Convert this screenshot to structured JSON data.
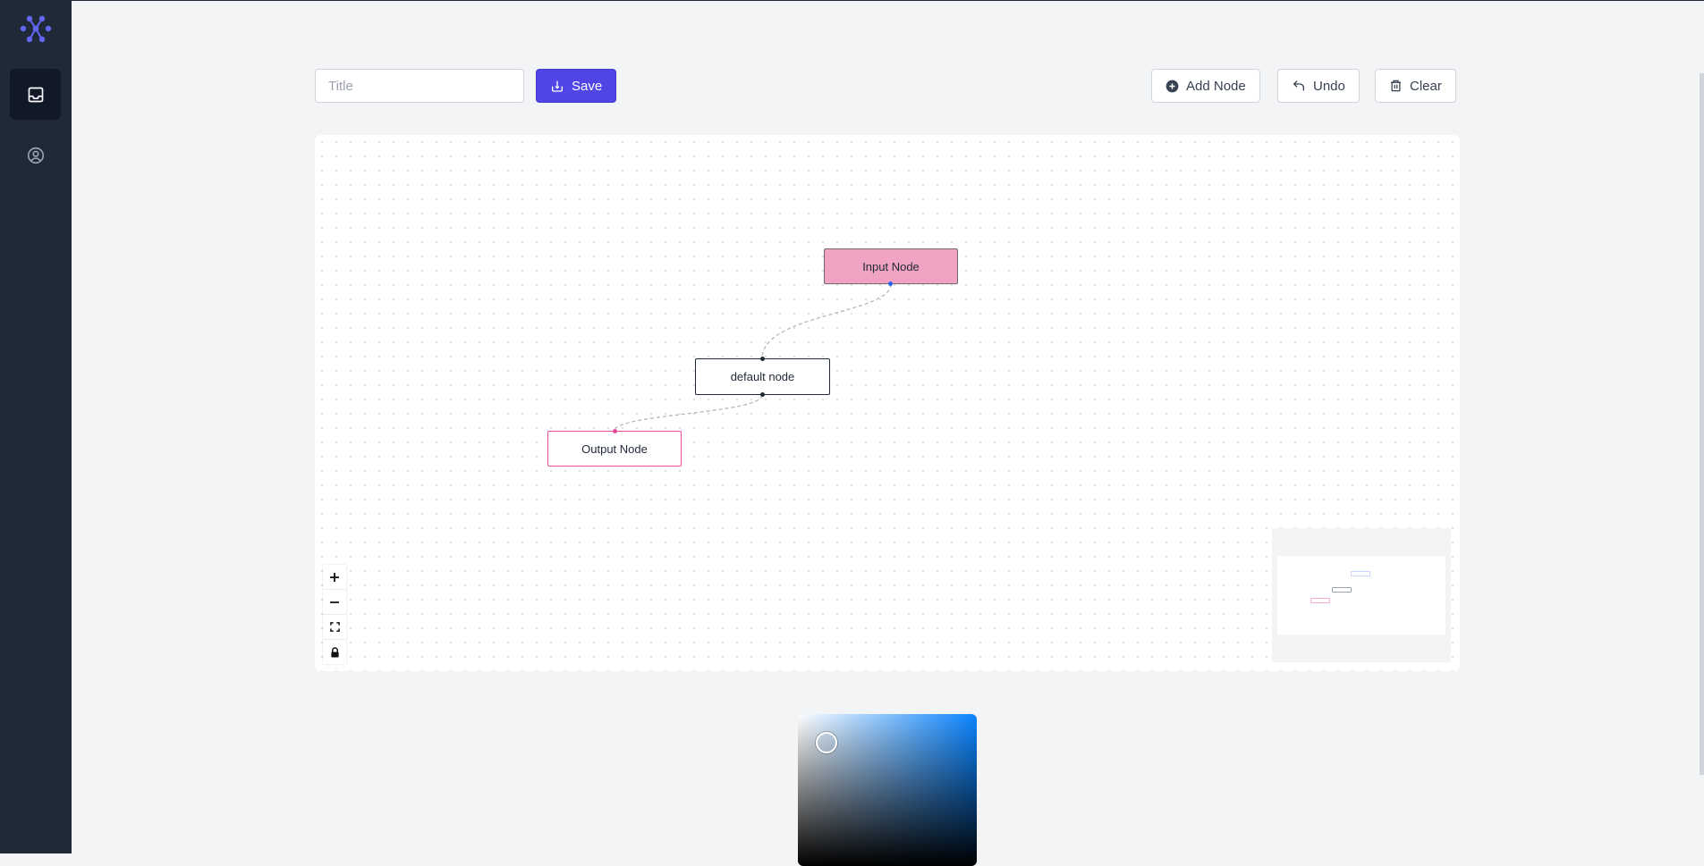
{
  "sidebar": {
    "logo_icon": "logo-icon",
    "items": [
      {
        "icon": "inbox-icon",
        "active": true
      },
      {
        "icon": "user-circle-icon",
        "active": false
      }
    ]
  },
  "toolbar": {
    "title_placeholder": "Title",
    "title_value": "",
    "save_label": "Save",
    "add_node_label": "Add Node",
    "undo_label": "Undo",
    "clear_label": "Clear"
  },
  "flow": {
    "nodes": [
      {
        "id": "input",
        "label": "Input Node",
        "type": "input"
      },
      {
        "id": "default",
        "label": "default node",
        "type": "default"
      },
      {
        "id": "output",
        "label": "Output Node",
        "type": "output"
      }
    ],
    "edges": [
      {
        "source": "input",
        "target": "default"
      },
      {
        "source": "default",
        "target": "output"
      }
    ]
  },
  "controls": [
    "zoom-in",
    "zoom-out",
    "fit-view",
    "lock"
  ],
  "colors": {
    "accent": "#4f46e5",
    "sidebar_bg": "#1f2937",
    "input_node": "#f0a3c2",
    "output_node_border": "#ec4899",
    "picker_hue": "#0a84ff"
  }
}
